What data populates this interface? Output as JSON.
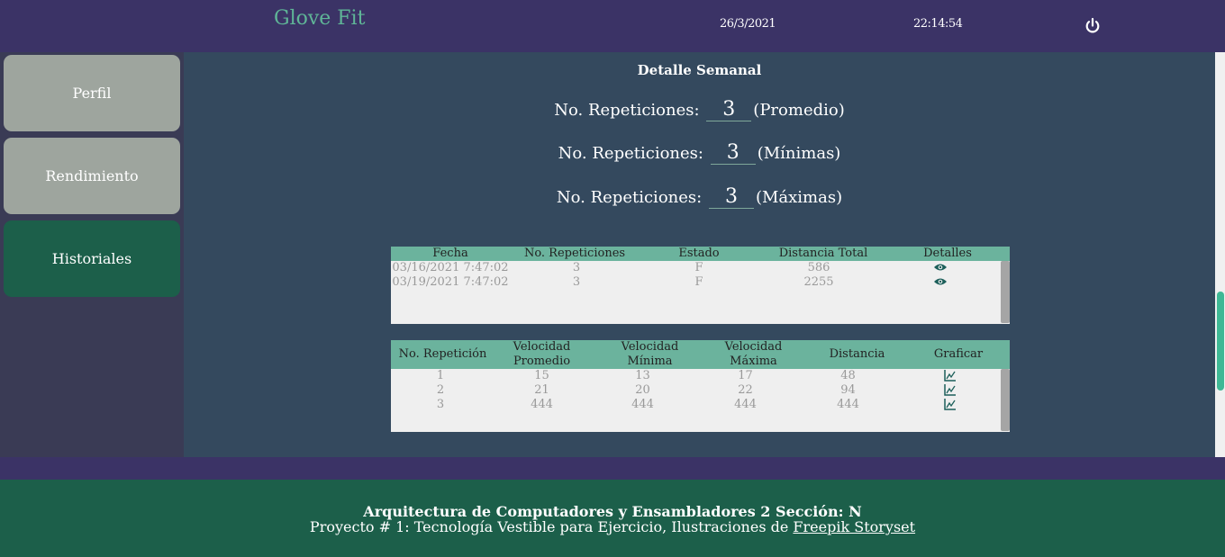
{
  "header": {
    "brand": "Glove Fit",
    "date": "26/3/2021",
    "time": "22:14:54",
    "power_icon": "power-icon"
  },
  "sidebar": {
    "items": [
      {
        "label": "Perfil"
      },
      {
        "label": "Rendimiento"
      },
      {
        "label": "Historiales"
      }
    ]
  },
  "main": {
    "title": "Detalle Semanal",
    "reps": [
      {
        "prefix": "No. Repeticiones:",
        "value": "3",
        "suffix": "(Promedio)"
      },
      {
        "prefix": "No. Repeticiones:",
        "value": "3",
        "suffix": "(Mínimas)"
      },
      {
        "prefix": "No. Repeticiones:",
        "value": "3",
        "suffix": "(Máximas)"
      }
    ]
  },
  "history_table": {
    "headers": [
      "Fecha",
      "No. Repeticiones",
      "Estado",
      "Distancia Total",
      "Detalles"
    ],
    "rows": [
      {
        "fecha": "03/16/2021 7:47:02",
        "reps": "3",
        "estado": "F",
        "distancia": "586",
        "detalles_icon": "eye-icon"
      },
      {
        "fecha": "03/19/2021 7:47:02",
        "reps": "3",
        "estado": "F",
        "distancia": "2255",
        "detalles_icon": "eye-icon"
      }
    ]
  },
  "detail_table": {
    "headers": [
      {
        "l1": "No. Repetición",
        "l2": ""
      },
      {
        "l1": "Velocidad",
        "l2": "Promedio"
      },
      {
        "l1": "Velocidad",
        "l2": "Mínima"
      },
      {
        "l1": "Velocidad",
        "l2": "Máxima"
      },
      {
        "l1": "Distancia",
        "l2": ""
      },
      {
        "l1": "Graficar",
        "l2": ""
      }
    ],
    "rows": [
      {
        "n": "1",
        "prom": "15",
        "min": "13",
        "max": "17",
        "dist": "48",
        "graficar_icon": "chart-icon"
      },
      {
        "n": "2",
        "prom": "21",
        "min": "20",
        "max": "22",
        "dist": "94",
        "graficar_icon": "chart-icon"
      },
      {
        "n": "3",
        "prom": "444",
        "min": "444",
        "max": "444",
        "dist": "444",
        "graficar_icon": "chart-icon"
      }
    ]
  },
  "footer": {
    "line1": "Arquitectura de Computadores y Ensambladores 2 Sección: N",
    "line2": "Proyecto # 1: Tecnología Vestible para Ejercicio, Ilustraciones de",
    "link": "Freepik Storyset"
  },
  "colors": {
    "header_bg": "#3b3366",
    "main_bg": "#34495e",
    "accent_green": "#1c5f4a",
    "table_header": "#6bb39d",
    "sidebar_gray": "#9ea59e",
    "brand_text": "#5fb597"
  }
}
